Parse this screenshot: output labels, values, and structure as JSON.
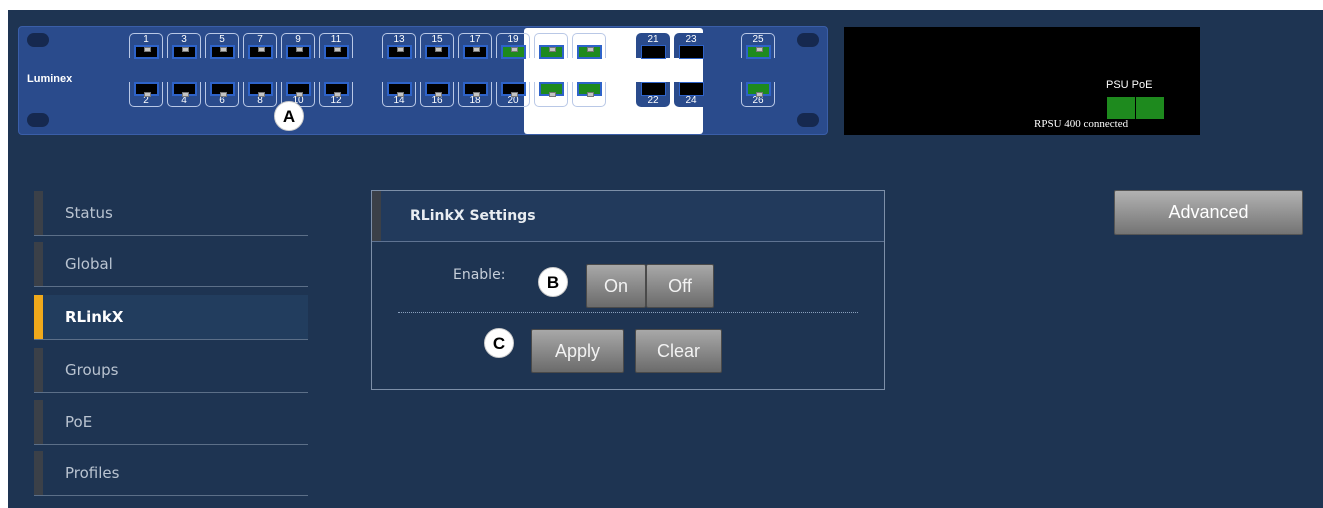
{
  "brand": "Luminex",
  "ports": {
    "top_row": [
      {
        "label": "1",
        "state": "blue"
      },
      {
        "label": "3",
        "state": "blue"
      },
      {
        "label": "5",
        "state": "blue"
      },
      {
        "label": "7",
        "state": "blue"
      },
      {
        "label": "9",
        "state": "blue"
      },
      {
        "label": "11",
        "state": "blue"
      },
      {
        "label": "13",
        "state": "blue"
      },
      {
        "label": "15",
        "state": "blue"
      },
      {
        "label": "17",
        "state": "blue"
      },
      {
        "label": "19",
        "state": "green"
      },
      {
        "label": "21",
        "state": "green"
      },
      {
        "label": "23",
        "state": "green"
      }
    ],
    "bottom_row": [
      {
        "label": "2",
        "state": "blue"
      },
      {
        "label": "4",
        "state": "blue"
      },
      {
        "label": "6",
        "state": "blue"
      },
      {
        "label": "8",
        "state": "blue"
      },
      {
        "label": "10",
        "state": "blue"
      },
      {
        "label": "12",
        "state": "blue"
      },
      {
        "label": "14",
        "state": "blue"
      },
      {
        "label": "16",
        "state": "blue"
      },
      {
        "label": "18",
        "state": "blue"
      },
      {
        "label": "20",
        "state": "blue"
      },
      {
        "label": "22",
        "state": "green"
      },
      {
        "label": "24",
        "state": "green"
      }
    ],
    "sfp_top": [
      "21",
      "23"
    ],
    "sfp_bottom": [
      "22",
      "24"
    ],
    "extra_top": "25",
    "extra_bottom": "26"
  },
  "psu": {
    "label": "PSU PoE",
    "status": "RPSU 400 connected"
  },
  "markers": {
    "a": "A",
    "b": "B",
    "c": "C"
  },
  "sidebar": {
    "items": [
      {
        "label": "Status"
      },
      {
        "label": "Global"
      },
      {
        "label": "RLinkX",
        "active": true
      },
      {
        "label": "Groups"
      },
      {
        "label": "PoE"
      },
      {
        "label": "Profiles"
      }
    ]
  },
  "settings": {
    "title": "RLinkX Settings",
    "enable_label": "Enable:",
    "on_label": "On",
    "off_label": "Off",
    "apply_label": "Apply",
    "clear_label": "Clear"
  },
  "advanced_label": "Advanced",
  "colors": {
    "background": "#1e3452",
    "panel": "#2a4b8c",
    "port_link": "#1e8a1e",
    "active_accent": "#f0a91b"
  }
}
